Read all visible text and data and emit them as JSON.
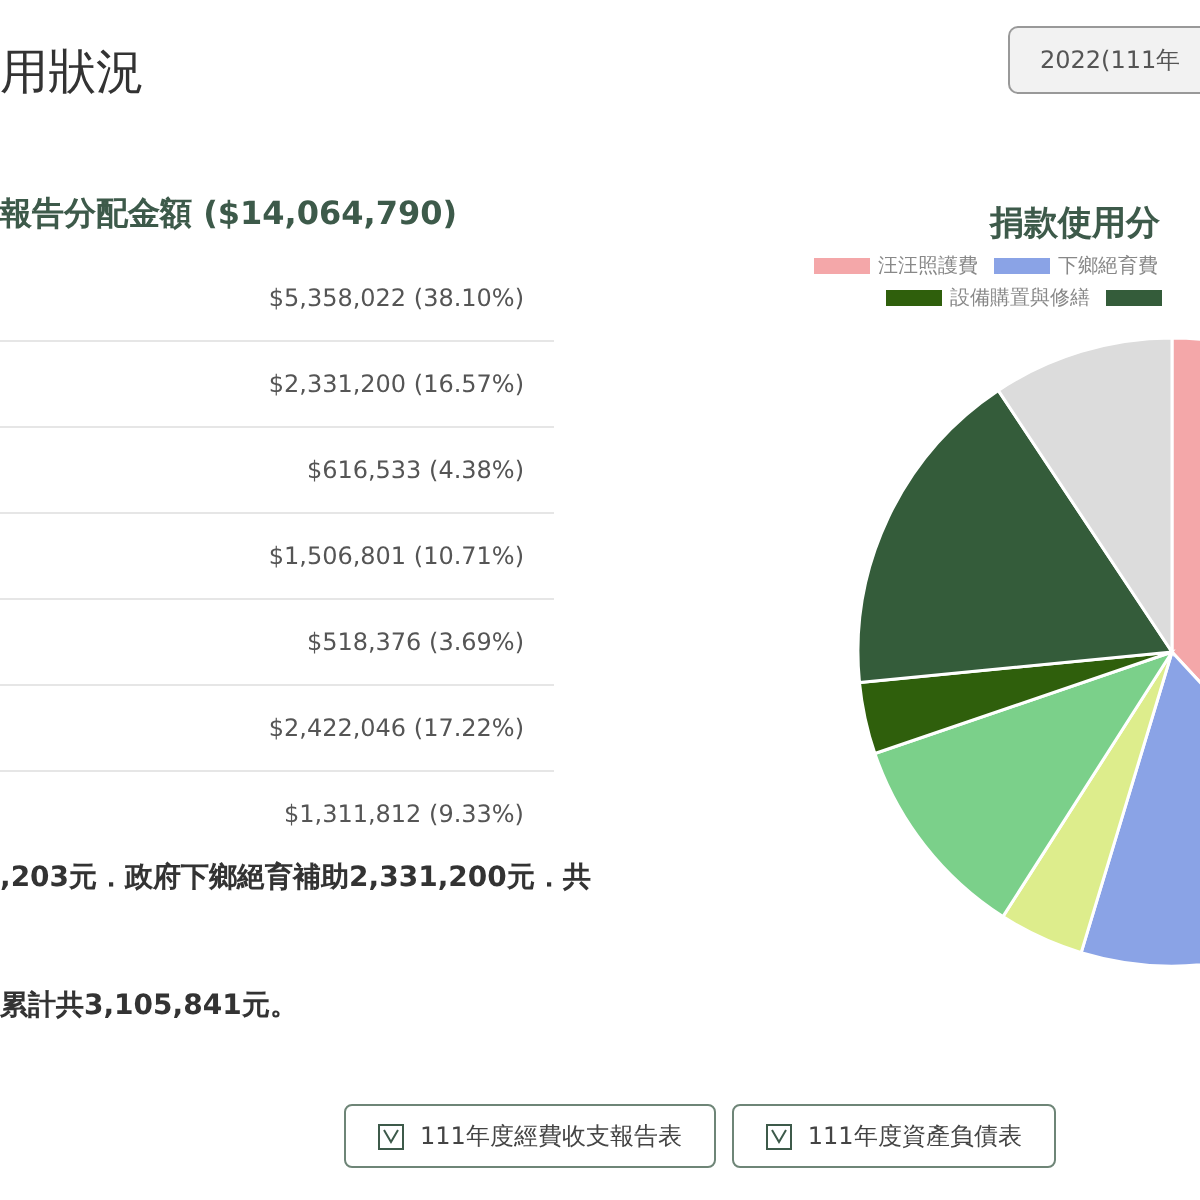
{
  "page_title": "用狀況",
  "year_select": {
    "value": "2022(111年"
  },
  "table": {
    "heading": "報告分配金額 ($14,064,790)",
    "rows": [
      {
        "amount": "$5,358,022 (38.10%)"
      },
      {
        "amount": "$2,331,200 (16.57%)"
      },
      {
        "amount": "$616,533 (4.38%)"
      },
      {
        "amount": "$1,506,801 (10.71%)"
      },
      {
        "amount": "$518,376 (3.69%)"
      },
      {
        "amount": "$2,422,046 (17.22%)"
      },
      {
        "amount": "$1,311,812 (9.33%)"
      }
    ]
  },
  "notes": [
    ",203元．政府下鄉絕育補助2,331,200元．共",
    "累計共3,105,841元。"
  ],
  "chart": {
    "legend": [
      {
        "label": "汪汪照護費",
        "color": "#f4a7a9"
      },
      {
        "label": "下鄉絕育費",
        "color": "#8aa3e6"
      },
      {
        "label": "設備購置與修繕",
        "color": "#2f5f0c"
      },
      {
        "color": "#345c3a"
      }
    ],
    "chart_data": {
      "type": "pie",
      "title": "捐款使用分",
      "values": [
        38.1,
        16.57,
        4.38,
        10.71,
        3.69,
        17.22,
        9.33
      ],
      "colors": [
        "#f4a7a9",
        "#8aa3e6",
        "#dded8c",
        "#7bd08a",
        "#2f5f0c",
        "#345c3a",
        "#dcdcdc"
      ]
    }
  },
  "buttons": [
    {
      "label": "111年度經費收支報告表"
    },
    {
      "label": "111年度資產負債表"
    }
  ]
}
